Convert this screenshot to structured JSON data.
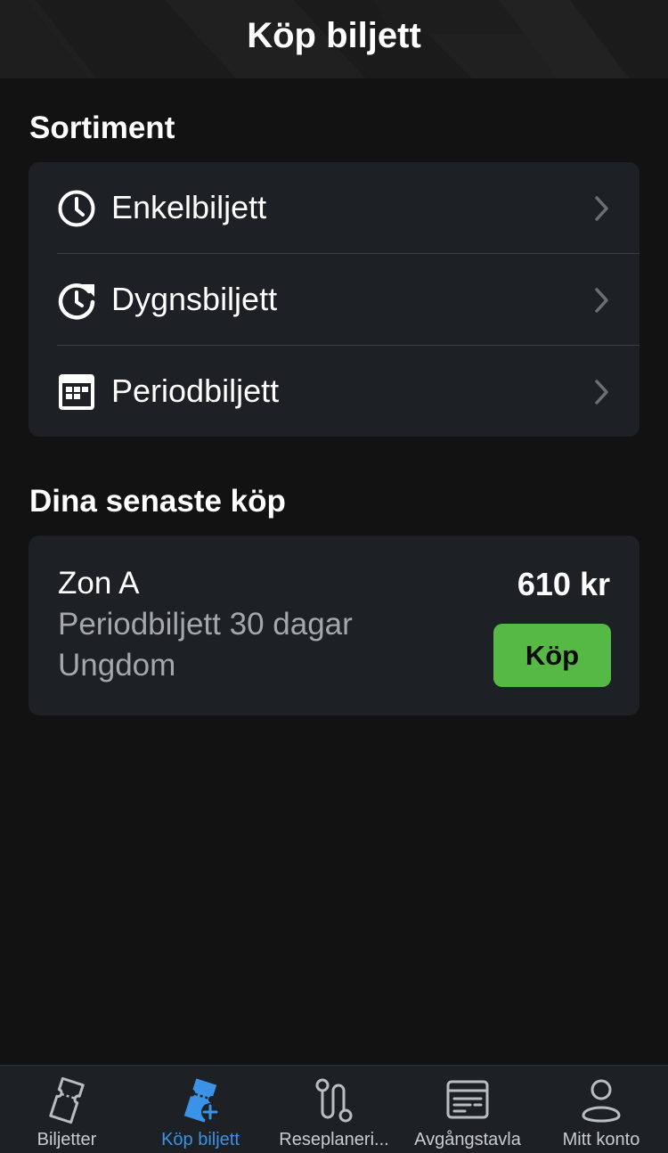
{
  "header": {
    "title": "Köp biljett"
  },
  "assortment": {
    "title": "Sortiment",
    "items": [
      {
        "label": "Enkelbiljett",
        "icon": "clock-icon"
      },
      {
        "label": "Dygnsbiljett",
        "icon": "clock-refresh-icon"
      },
      {
        "label": "Periodbiljett",
        "icon": "calendar-icon"
      }
    ]
  },
  "recent": {
    "title": "Dina senaste köp",
    "item": {
      "zone": "Zon A",
      "type": "Periodbiljett 30 dagar",
      "category": "Ungdom",
      "price": "610 kr",
      "buy_label": "Köp"
    }
  },
  "tabbar": {
    "items": [
      {
        "label": "Biljetter",
        "icon": "ticket-icon",
        "active": false
      },
      {
        "label": "Köp biljett",
        "icon": "ticket-plus-icon",
        "active": true
      },
      {
        "label": "Reseplaneri...",
        "icon": "route-icon",
        "active": false
      },
      {
        "label": "Avgångstavla",
        "icon": "departure-board-icon",
        "active": false
      },
      {
        "label": "Mitt konto",
        "icon": "user-icon",
        "active": false
      }
    ]
  },
  "colors": {
    "background": "#121212",
    "card": "#1d2024",
    "accent_blue": "#3a93e6",
    "buy_green": "#56b946",
    "secondary_text": "#a4a7ac"
  }
}
